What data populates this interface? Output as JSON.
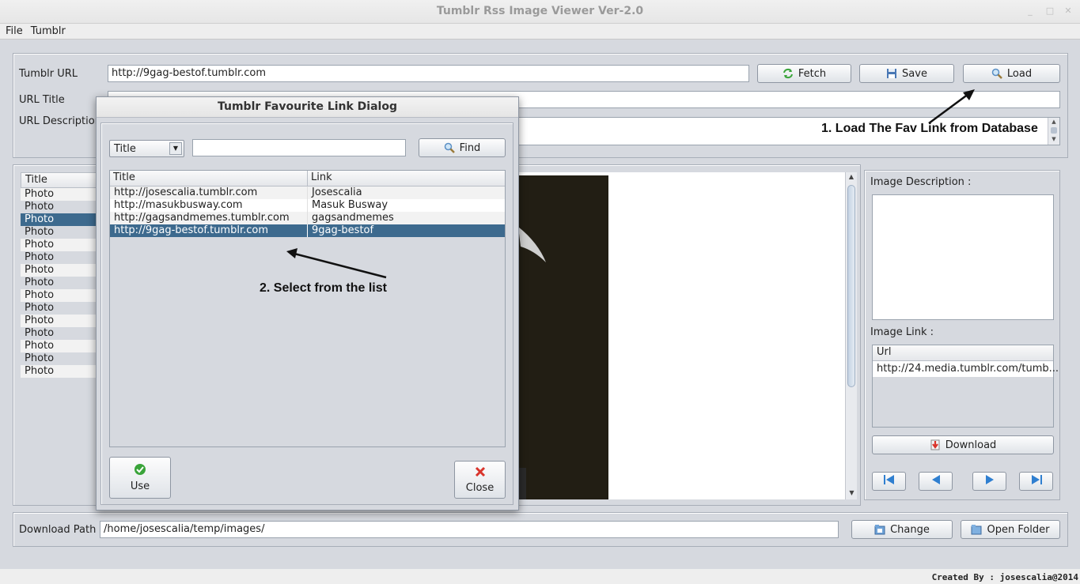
{
  "window": {
    "title": "Tumblr Rss Image Viewer Ver-2.0"
  },
  "menu": [
    "File",
    "Tumblr"
  ],
  "top": {
    "url_label": "Tumblr URL",
    "url_value": "http://9gag-bestof.tumblr.com",
    "title_label": "URL Title",
    "desc_label": "URL Description",
    "fetch": "Fetch",
    "save": "Save",
    "load": "Load"
  },
  "left_table": {
    "header": "Title",
    "rows": [
      "Photo",
      "Photo",
      "Photo",
      "Photo",
      "Photo",
      "Photo",
      "Photo",
      "Photo",
      "Photo",
      "Photo",
      "Photo",
      "Photo",
      "Photo",
      "Photo",
      "Photo"
    ],
    "selected_index": 2
  },
  "right_panel": {
    "desc_label": "Image Description :",
    "link_label": "Image Link :",
    "url_header": "Url",
    "url_value": "http://24.media.tumblr.com/tumb...",
    "download": "Download"
  },
  "bottom": {
    "path_label": "Download Path",
    "path_value": "/home/josescalia/temp/images/",
    "change": "Change",
    "open_folder": "Open Folder"
  },
  "credit": "Created By : josescalia@2014",
  "dialog": {
    "title": "Tumblr Favourite Link Dialog",
    "combo_value": "Title",
    "search_value": "",
    "find": "Find",
    "col_title": "Title",
    "col_link": "Link",
    "rows": [
      {
        "title": "http://josescalia.tumblr.com",
        "link": "Josescalia"
      },
      {
        "title": "http://masukbusway.com",
        "link": "Masuk Busway"
      },
      {
        "title": "http://gagsandmemes.tumblr.com",
        "link": "gagsandmemes"
      },
      {
        "title": "http://9gag-bestof.tumblr.com",
        "link": "9gag-bestof"
      }
    ],
    "selected_index": 3,
    "use": "Use",
    "close": "Close"
  },
  "annotations": {
    "step1": "1. Load The Fav Link from Database",
    "step2": "2. Select from the list"
  },
  "colors": {
    "selection": "#3d6a8e",
    "close_icon": "#d9342b",
    "use_icon": "#3aa43a",
    "nav_icon": "#2f7fd0"
  }
}
